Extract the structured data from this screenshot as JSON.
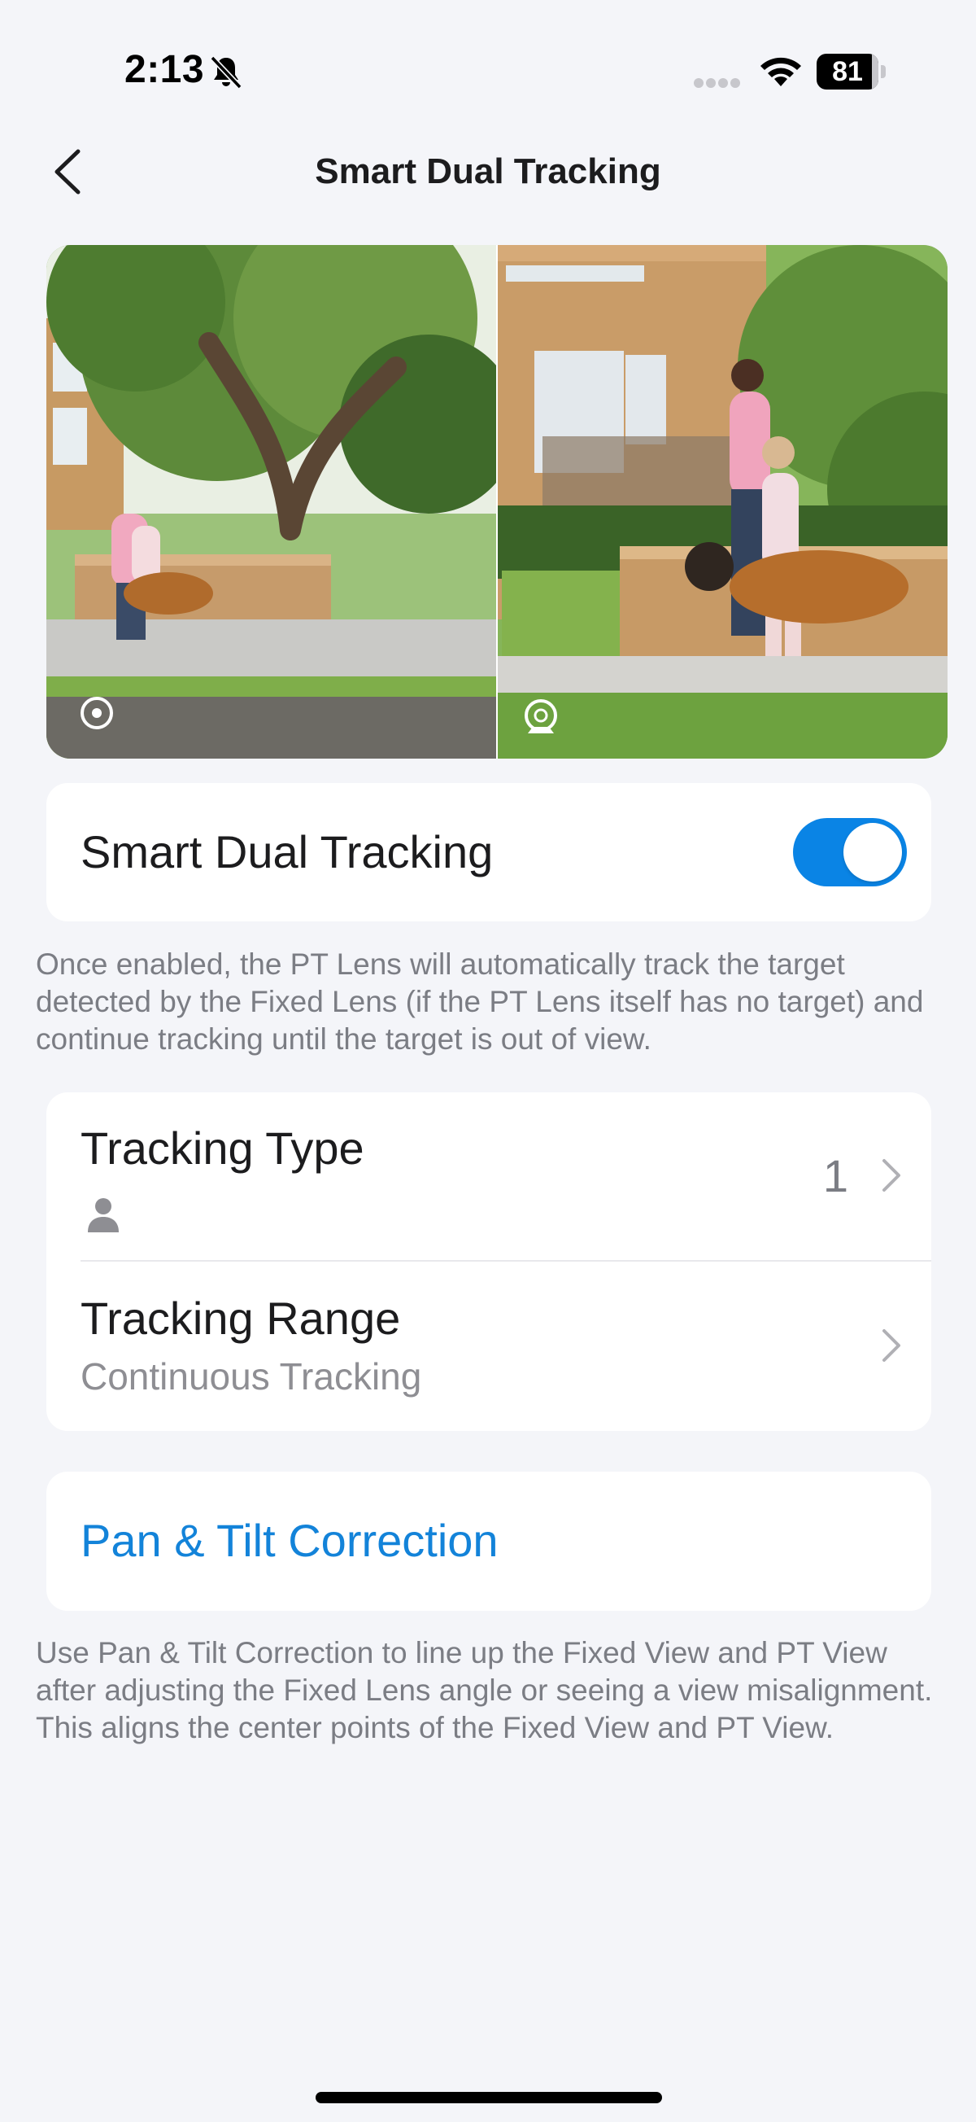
{
  "status_bar": {
    "time": "2:13",
    "battery": "81",
    "icons": [
      "bell-slash-icon",
      "signal-icon",
      "wifi-icon",
      "battery-icon"
    ]
  },
  "nav": {
    "title": "Smart Dual Tracking",
    "back_icon": "chevron-left-icon"
  },
  "preview": {
    "left_lens_icon": "fixed-lens-icon",
    "right_lens_icon": "pt-lens-icon"
  },
  "toggle_section": {
    "label": "Smart Dual Tracking",
    "enabled": true,
    "accent_color": "#0A84E5",
    "description": "Once enabled, the PT Lens will automatically track the target detected by the Fixed Lens (if the PT Lens itself has no target) and continue tracking until the target is out of view."
  },
  "tracking": {
    "type_label": "Tracking Type",
    "type_value": "1",
    "type_icon": "person-icon",
    "range_label": "Tracking Range",
    "range_value": "Continuous Tracking"
  },
  "correction": {
    "label": "Pan & Tilt Correction",
    "link_color": "#1383D9",
    "description": "Use Pan & Tilt Correction to line up the Fixed View and PT View after adjusting the Fixed Lens angle or seeing a view misalignment. This aligns the center points of the Fixed View and PT View."
  }
}
